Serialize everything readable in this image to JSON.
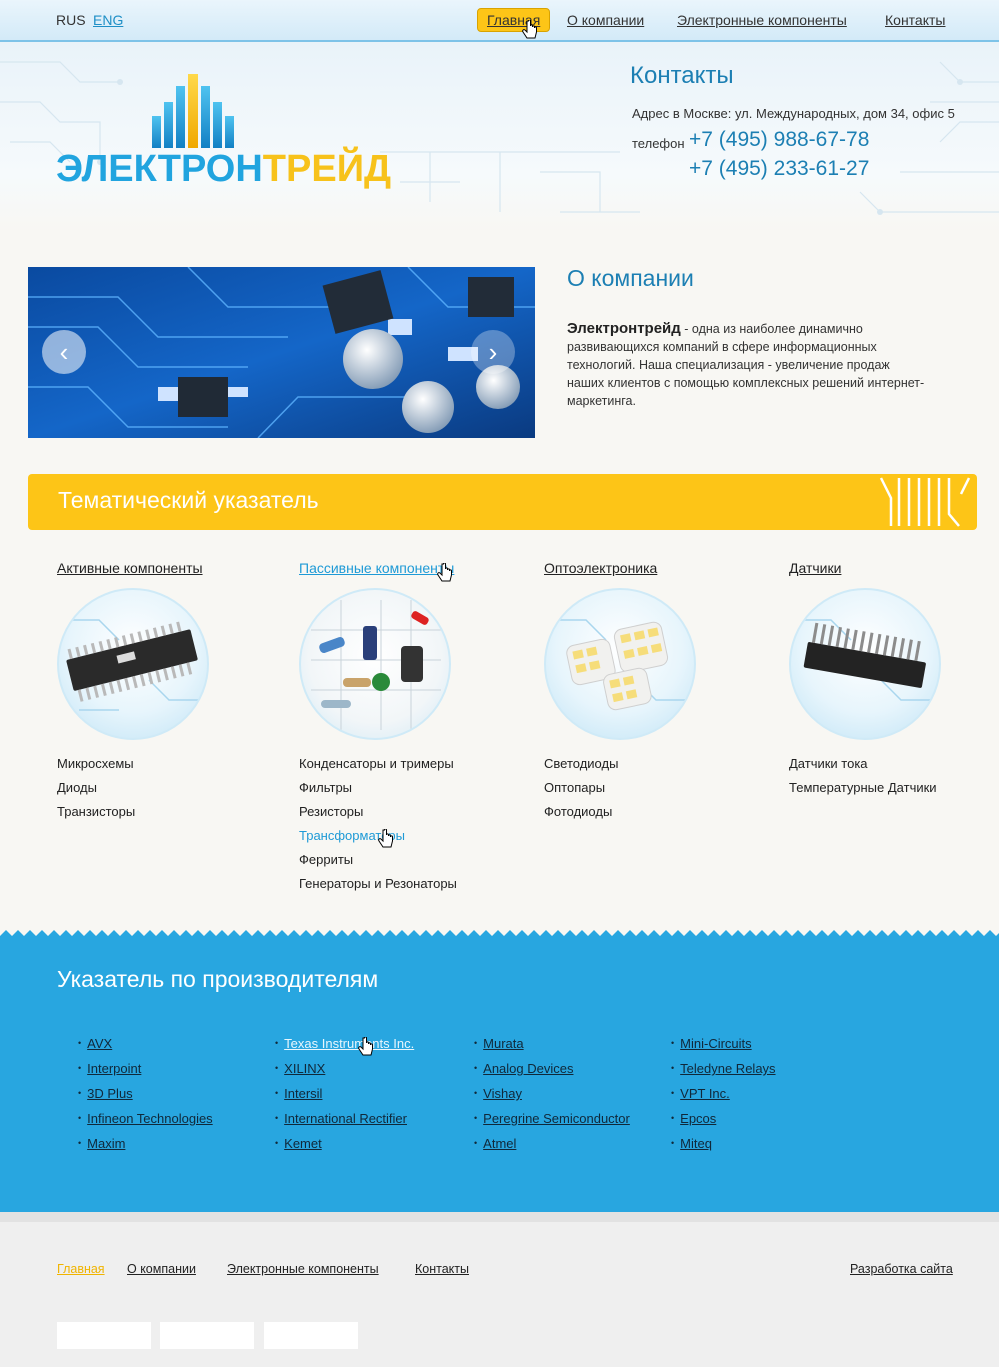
{
  "lang": {
    "rus": "RUS",
    "eng": "ENG"
  },
  "nav": [
    {
      "label": "Главная",
      "active": true
    },
    {
      "label": "О компании"
    },
    {
      "label": "Электронные компоненты"
    },
    {
      "label": "Контакты"
    }
  ],
  "logo": {
    "part1": "ЭЛЕКТРОН",
    "part2": "ТРЕЙД"
  },
  "contacts": {
    "title": "Контакты",
    "address": "Адрес в Москве: ул. Международных, дом 34, офис 5",
    "phone_label": "телефон",
    "phone1": "+7 (495) 988-67-78",
    "phone2": "+7 (495) 233-61-27"
  },
  "about": {
    "title": "О компании",
    "company": "Электронтрейд",
    "text": " - одна из наиболее динамично развивающихся компаний в сфере информационных технологий.  Наша специализация - увеличение продаж наших клиентов с помощью комплексных решений интернет-маркетинга."
  },
  "thematic": {
    "title": "Тематический указатель"
  },
  "categories": [
    {
      "title": "Активные компоненты",
      "items": [
        "Микросхемы",
        "Диоды",
        "Транзисторы"
      ]
    },
    {
      "title": "Пассивные компоненты",
      "items": [
        "Конденсаторы и тримеры",
        "Фильтры",
        "Резисторы",
        "Трансформаторы",
        "Ферриты",
        "Генераторы и Резонаторы"
      ]
    },
    {
      "title": "Оптоэлектроника",
      "items": [
        "Светодиоды",
        "Оптопары",
        "Фотодиоды"
      ]
    },
    {
      "title": "Датчики",
      "items": [
        "Датчики тока",
        "Температурные Датчики"
      ]
    }
  ],
  "manufacturers": {
    "title": "Указатель по производителям",
    "columns": [
      [
        "AVX",
        "Interpoint",
        "3D Plus",
        "Infineon Technologies",
        "Maxim"
      ],
      [
        "Texas Instruments Inc.",
        "XILINX",
        "Intersil",
        "International Rectifier",
        "Kemet"
      ],
      [
        "Murata",
        "Analog Devices",
        "Vishay",
        "Peregrine Semiconductor",
        "Atmel"
      ],
      [
        "Mini-Circuits",
        "Teledyne Relays",
        "VPT Inc.",
        "Epcos",
        "Miteq"
      ]
    ]
  },
  "footer": {
    "links": [
      "Главная",
      "О компании",
      "Электронные компоненты",
      "Контакты"
    ],
    "dev": "Разработка сайта"
  },
  "colors": {
    "blue": "#28a6e0",
    "yellow": "#fdc517",
    "title_blue": "#1c7fb3"
  }
}
